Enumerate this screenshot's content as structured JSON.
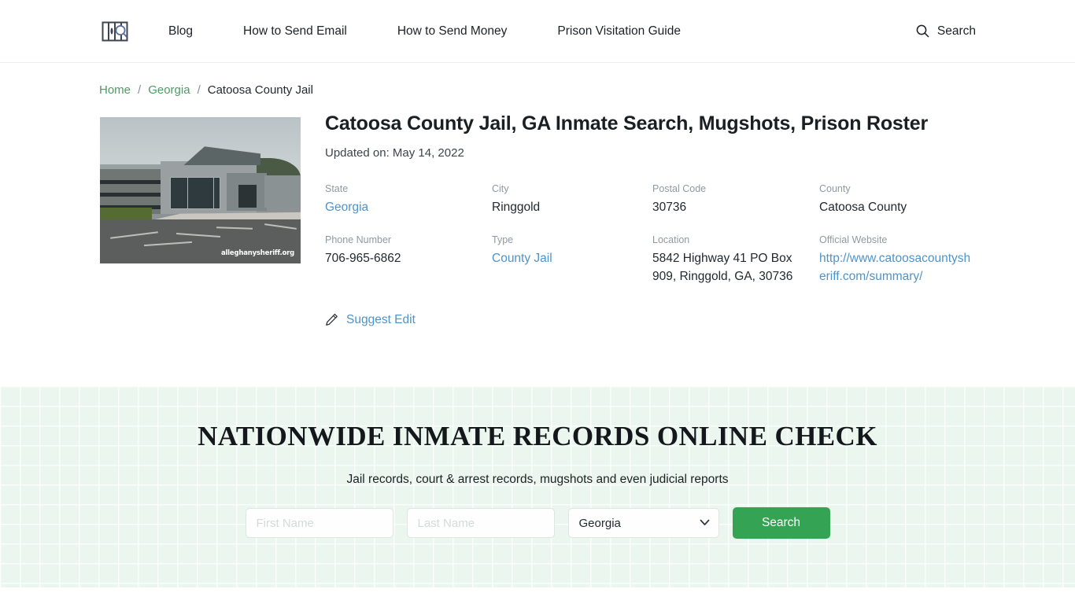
{
  "header": {
    "logo_name": "jail-bars-magnifier-logo",
    "nav": [
      {
        "label": "Blog"
      },
      {
        "label": "How to Send Email"
      },
      {
        "label": "How to Send Money"
      },
      {
        "label": "Prison Visitation Guide"
      }
    ],
    "search_label": "Search"
  },
  "breadcrumb": {
    "items": [
      {
        "label": "Home",
        "type": "link"
      },
      {
        "label": "Georgia",
        "type": "link"
      },
      {
        "label": "Catoosa County Jail",
        "type": "current"
      }
    ],
    "separator": "/"
  },
  "facility": {
    "title": "Catoosa County Jail, GA Inmate Search, Mugshots, Prison Roster",
    "updated": "Updated on: May 14, 2022",
    "photo_watermark": "alleghanysheriff.org",
    "fields": [
      {
        "label": "State",
        "value": "Georgia",
        "link": true
      },
      {
        "label": "City",
        "value": "Ringgold",
        "link": false
      },
      {
        "label": "Postal Code",
        "value": "30736",
        "link": false
      },
      {
        "label": "County",
        "value": "Catoosa County",
        "link": false
      },
      {
        "label": "Phone Number",
        "value": "706-965-6862",
        "link": false
      },
      {
        "label": "Type",
        "value": "County Jail",
        "link": true
      },
      {
        "label": "Location",
        "value": "5842 Highway 41 PO Box 909, Ringgold, GA, 30736",
        "link": false
      },
      {
        "label": "Official Website",
        "value": "http://www.catoosacountysheriff.com/summary/",
        "link": true
      }
    ],
    "suggest_edit_label": "Suggest Edit"
  },
  "banner": {
    "title": "NATIONWIDE INMATE RECORDS ONLINE CHECK",
    "subtitle": "Jail records, court & arrest records, mugshots and even judicial reports",
    "first_name_placeholder": "First Name",
    "first_name_value": "",
    "last_name_placeholder": "Last Name",
    "last_name_value": "",
    "state_selected": "Georgia",
    "state_options": [
      "Georgia"
    ],
    "search_button": "Search"
  },
  "colors": {
    "accent_green": "#34a353",
    "link_blue": "#4f93c9",
    "breadcrumb_green": "#4e9a63",
    "banner_bg": "#eaf6ee"
  }
}
